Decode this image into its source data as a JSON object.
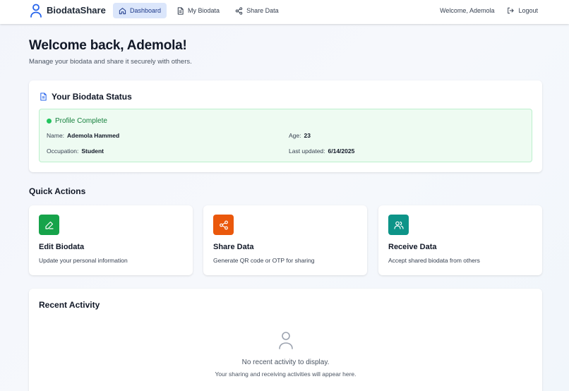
{
  "app": {
    "brand": "BiodataShare"
  },
  "nav": {
    "items": [
      {
        "label": "Dashboard",
        "icon": "home-icon",
        "active": true
      },
      {
        "label": "My Biodata",
        "icon": "document-icon",
        "active": false
      },
      {
        "label": "Share Data",
        "icon": "share-icon",
        "active": false
      }
    ],
    "welcome": "Welcome, Ademola",
    "logout": "Logout"
  },
  "welcome": {
    "title": "Welcome back, Ademola!",
    "subtitle": "Manage your biodata and share it securely with others."
  },
  "status": {
    "title": "Your Biodata Status",
    "state": "Profile Complete",
    "name_label": "Name:",
    "name": "Ademola Hammed",
    "age_label": "Age:",
    "age": "23",
    "occupation_label": "Occupation:",
    "occupation": "Student",
    "updated_label": "Last updated:",
    "updated": "6/14/2025"
  },
  "quick_actions": {
    "title": "Quick Actions",
    "items": [
      {
        "title": "Edit Biodata",
        "desc": "Update your personal information",
        "icon": "pencil-icon",
        "color": "#16a34a"
      },
      {
        "title": "Share Data",
        "desc": "Generate QR code or OTP for sharing",
        "icon": "share-icon",
        "color": "#ea580c"
      },
      {
        "title": "Receive Data",
        "desc": "Accept shared biodata from others",
        "icon": "users-icon",
        "color": "#0d9488"
      }
    ]
  },
  "activity": {
    "title": "Recent Activity",
    "empty": "No recent activity to display.",
    "empty_sub": "Your sharing and receiving activities will appear here."
  },
  "colors": {
    "accent": "#2563eb",
    "active_nav_bg": "#dbe6fb",
    "success": "#22c55e",
    "success_bg": "#eefbf2"
  }
}
